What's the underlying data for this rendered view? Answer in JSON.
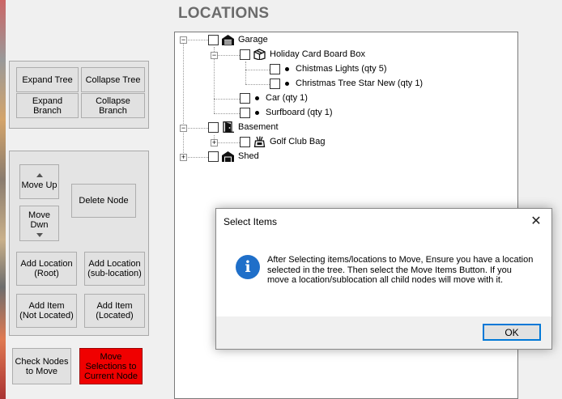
{
  "page_title": "LOCATIONS",
  "tree_buttons": {
    "expand_tree": "Expand Tree",
    "collapse_tree": "Collapse Tree",
    "expand_branch": "Expand Branch",
    "collapse_branch": "Collapse\nBranch"
  },
  "node_buttons": {
    "move_up": "Move Up",
    "move_down": "Move\nDwn",
    "delete_node": "Delete Node",
    "add_location_root": "Add Location\n(Root)",
    "add_location_sub": "Add Location\n(sub-location)",
    "add_item_not_located": "Add Item\n(Not Located)",
    "add_item_located": "Add Item\n(Located)"
  },
  "bottom_buttons": {
    "check_nodes": "Check Nodes\nto Move",
    "move_selections": "Move\nSelections to\nCurrent Node"
  },
  "colors": {
    "move_button": "#f00000",
    "title": "#6b6b6b",
    "info_icon": "#1f6fc9",
    "ok_border": "#0078d7"
  },
  "tree": {
    "nodes": [
      {
        "label": "Garage",
        "icon": "garage-icon",
        "expander": "−"
      },
      {
        "label": "Holiday Card Board Box",
        "icon": "box-icon",
        "expander": "−"
      },
      {
        "label": "Chistmas Lights (qty 5)",
        "icon": "bullet"
      },
      {
        "label": "Christmas Tree Star New (qty 1)",
        "icon": "bullet"
      },
      {
        "label": "Car (qty 1)",
        "icon": "bullet"
      },
      {
        "label": "Surfboard (qty 1)",
        "icon": "bullet"
      },
      {
        "label": "Basement",
        "icon": "door-icon",
        "expander": "−"
      },
      {
        "label": "Golf Club Bag",
        "icon": "golf-bag-icon",
        "expander": "+"
      },
      {
        "label": "Shed",
        "icon": "shed-icon",
        "expander": "+"
      }
    ]
  },
  "dialog": {
    "title": "Select Items",
    "close": "✕",
    "icon_glyph": "i",
    "message": "After Selecting items/locations to Move, Ensure you have a location selected in the tree. Then select the Move Items Button. If you move a location/sublocation all child nodes will move with it.",
    "ok": "OK"
  }
}
